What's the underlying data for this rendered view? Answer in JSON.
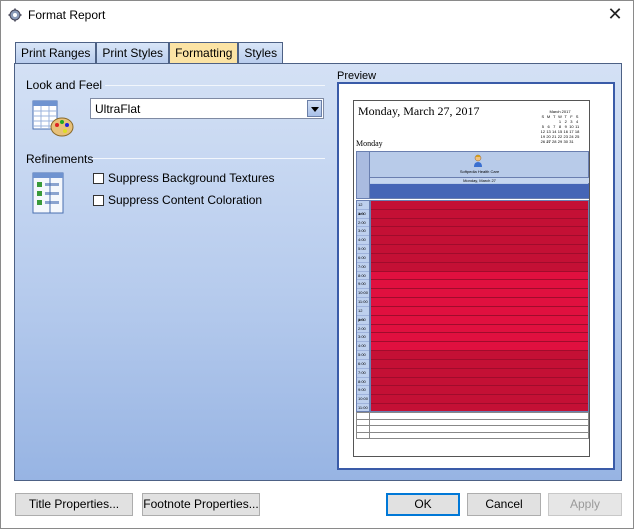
{
  "window": {
    "title": "Format Report",
    "close": "✕"
  },
  "tabs": [
    {
      "label": "Print Ranges",
      "active": false
    },
    {
      "label": "Print Styles",
      "active": false
    },
    {
      "label": "Formatting",
      "active": true
    },
    {
      "label": "Styles",
      "active": false
    }
  ],
  "look_and_feel": {
    "heading": "Look and Feel",
    "selected": "UltraFlat"
  },
  "refinements": {
    "heading": "Refinements",
    "options": [
      {
        "label": "Suppress Background Textures",
        "checked": false
      },
      {
        "label": "Suppress Content Coloration",
        "checked": false
      }
    ]
  },
  "preview": {
    "heading": "Preview",
    "page_title": "Monday, March 27, 2017",
    "day_label": "Monday",
    "calendar_month": "March 2017",
    "calendar_header": [
      "S",
      "M",
      "T",
      "W",
      "T",
      "F",
      "S"
    ],
    "calendar_days": [
      "",
      "",
      "",
      "1",
      "2",
      "3",
      "4",
      "5",
      "6",
      "7",
      "8",
      "9",
      "10",
      "11",
      "12",
      "13",
      "14",
      "15",
      "16",
      "17",
      "18",
      "19",
      "20",
      "21",
      "22",
      "23",
      "24",
      "25",
      "26",
      "27",
      "28",
      "29",
      "30",
      "31",
      ""
    ],
    "resource": "Softpedia Health Care",
    "day_header": "Monday, March 27",
    "times": [
      "12 am",
      "1:00",
      "2:00",
      "3:00",
      "4:00",
      "5:00",
      "6:00",
      "7:00",
      "8:00",
      "9:00",
      "10:00",
      "11:00",
      "12 pm",
      "1:00",
      "2:00",
      "3:00",
      "4:00",
      "5:00",
      "6:00",
      "7:00",
      "8:00",
      "9:00",
      "10:00",
      "11:00"
    ],
    "slot_colors": {
      "night": "#c41035",
      "day": "#e0103f"
    }
  },
  "buttons": {
    "title_properties": "Title Properties...",
    "footnote_properties": "Footnote Properties...",
    "ok": "OK",
    "cancel": "Cancel",
    "apply": "Apply"
  },
  "icons": {
    "app": "gear-icon",
    "look_and_feel": "palette-table-icon",
    "refinements": "checklist-icon"
  }
}
